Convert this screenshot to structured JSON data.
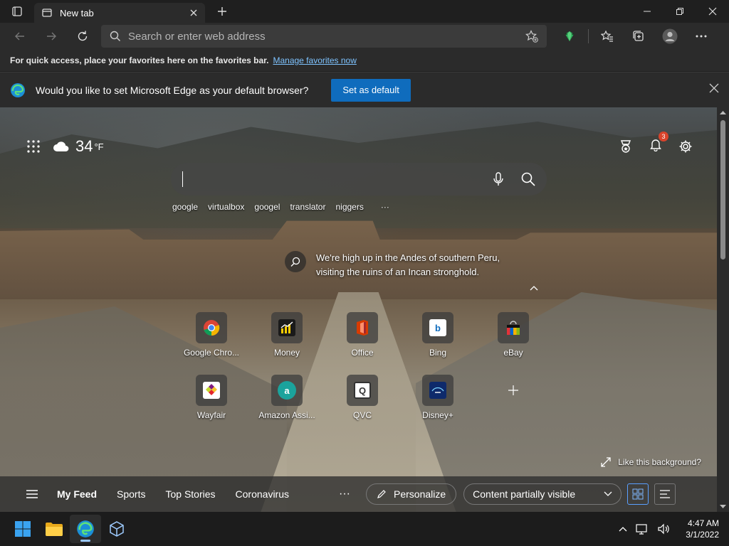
{
  "tab": {
    "title": "New tab"
  },
  "address": {
    "placeholder": "Search or enter web address"
  },
  "favorites_bar": {
    "message": "For quick access, place your favorites here on the favorites bar.",
    "link": "Manage favorites now"
  },
  "default_prompt": {
    "message": "Would you like to set Microsoft Edge as your default browser?",
    "button": "Set as default"
  },
  "weather": {
    "temp": "34",
    "unit": "°F"
  },
  "notifications": {
    "count": "3"
  },
  "quick_links": [
    "google",
    "virtualbox",
    "googel",
    "translator",
    "niggers"
  ],
  "quick_more": "···",
  "background_info": "We're high up in the Andes of southern Peru, visiting the ruins of an Incan stronghold.",
  "tiles": [
    {
      "name": "Google Chro...",
      "color": "#ffffff",
      "glyph": ""
    },
    {
      "name": "Money",
      "color": "#1a1a1a",
      "glyph": ""
    },
    {
      "name": "Office",
      "color": "#d83b01",
      "glyph": ""
    },
    {
      "name": "Bing",
      "color": "#ffffff",
      "glyph": "b"
    },
    {
      "name": "eBay",
      "color": "#1a1a1a",
      "glyph": ""
    },
    {
      "name": "Wayfair",
      "color": "#ffffff",
      "glyph": ""
    },
    {
      "name": "Amazon Assi...",
      "color": "#1ba39c",
      "glyph": "a"
    },
    {
      "name": "QVC",
      "color": "#ffffff",
      "glyph": "Q"
    },
    {
      "name": "Disney+",
      "color": "#0e2a6b",
      "glyph": ""
    }
  ],
  "like_background": "Like this background?",
  "feed": {
    "tabs": [
      "My Feed",
      "Sports",
      "Top Stories",
      "Coronavirus"
    ],
    "more": "···",
    "personalize": "Personalize",
    "visibility": "Content partially visible"
  },
  "clock": {
    "time": "4:47 AM",
    "date": "3/1/2022"
  }
}
